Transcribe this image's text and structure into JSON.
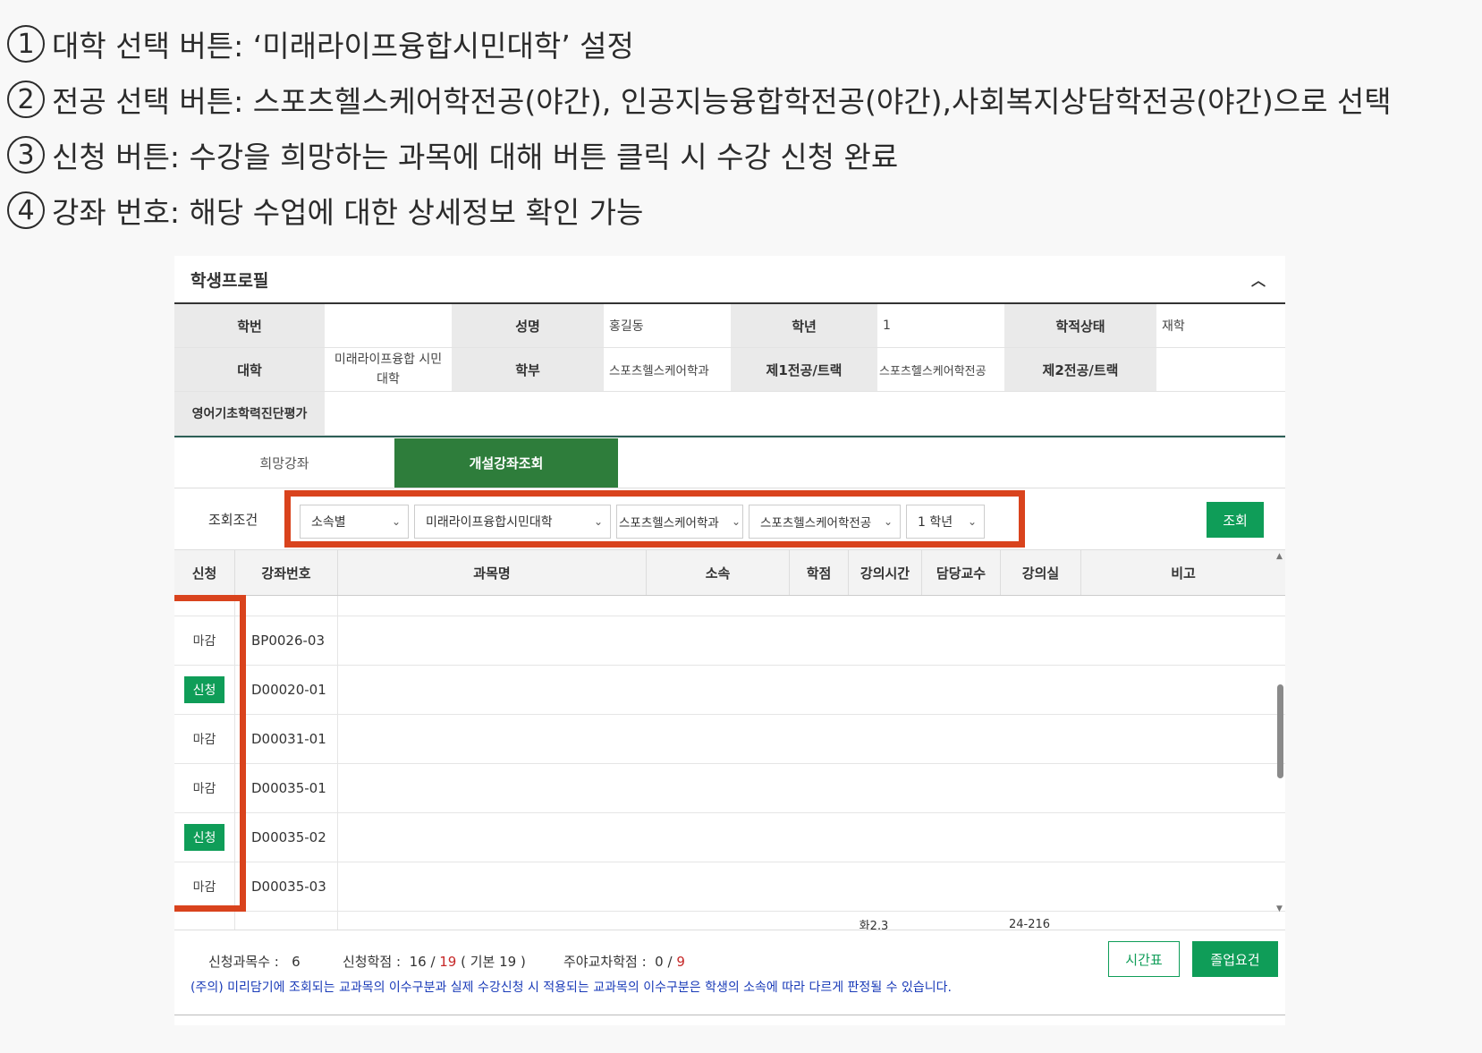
{
  "instructions": [
    {
      "num": "1",
      "text": "대학 선택 버튼: ‘미래라이프융합시민대학’ 설정"
    },
    {
      "num": "2",
      "text": "전공 선택 버튼: 스포츠헬스케어학전공(야간), 인공지능융합학전공(야간),사회복지상담학전공(야간)으로 선택"
    },
    {
      "num": "3",
      "text": "신청 버튼: 수강을 희망하는 과목에 대해 버튼 클릭 시 수강 신청 완료"
    },
    {
      "num": "4",
      "text": "강좌 번호: 해당 수업에 대한 상세정보 확인 가능"
    }
  ],
  "profile": {
    "title": "학생프로필",
    "labels": {
      "student_id": "학번",
      "name": "성명",
      "grade": "학년",
      "status": "학적상태",
      "college": "대학",
      "department": "학부",
      "major1": "제1전공/트랙",
      "major2": "제2전공/트랙",
      "english_test": "영어기초학력진단평가"
    },
    "values": {
      "student_id": "",
      "name": "홍길동",
      "grade": "1",
      "status": "재학",
      "college": "미래라이프융합 시민대학",
      "department": "스포츠헬스케어학과",
      "major1": "스포츠헬스케어학전공",
      "major2": "",
      "english_test": ""
    }
  },
  "tabs": [
    {
      "label": "희망강좌",
      "active": false
    },
    {
      "label": "개설강좌조회",
      "active": true
    }
  ],
  "search": {
    "label": "조회조건",
    "selects": [
      {
        "value": "소속별"
      },
      {
        "value": "미래라이프융합시민대학"
      },
      {
        "value": "스포츠헬스케어학과"
      },
      {
        "value": "스포츠헬스케어학전공"
      },
      {
        "value": "1 학년"
      }
    ],
    "button": "조회"
  },
  "grid": {
    "columns": [
      "신청",
      "강좌번호",
      "과목명",
      "소속",
      "학점",
      "강의시간",
      "담당교수",
      "강의실",
      "비고"
    ],
    "rows": [
      {
        "status": "마감",
        "code": "BP0026-03",
        "type": "closed"
      },
      {
        "status": "신청",
        "code": "D00020-01",
        "type": "apply"
      },
      {
        "status": "마감",
        "code": "D00031-01",
        "type": "closed"
      },
      {
        "status": "마감",
        "code": "D00035-01",
        "type": "closed"
      },
      {
        "status": "신청",
        "code": "D00035-02",
        "type": "apply"
      },
      {
        "status": "마감",
        "code": "D00035-03",
        "type": "closed"
      }
    ],
    "partial_bottom": {
      "time": "화2,3",
      "room": "24-216"
    }
  },
  "footer": {
    "count_label": "신청과목수 :",
    "count": "6",
    "credit_label": "신청학점 :",
    "credit_applied": "16",
    "credit_max": "19",
    "credit_base": "( 기본 19 )",
    "night_label": "주야교차학점 :",
    "night_applied": "0",
    "night_max": "9",
    "notice": "(주의) 미리담기에 조회되는 교과목의 이수구분과 실제 수강신청 시 적용되는 교과목의 이수구분은 학생의 소속에 따라 다르게 판정될 수 있습니다.",
    "timetable_button": "시간표",
    "graduation_button": "졸업요건"
  },
  "colors": {
    "accent": "#0f9d58",
    "tab_active": "#2e7d3b",
    "highlight": "#d9431d",
    "notice": "#1a3bb8"
  }
}
